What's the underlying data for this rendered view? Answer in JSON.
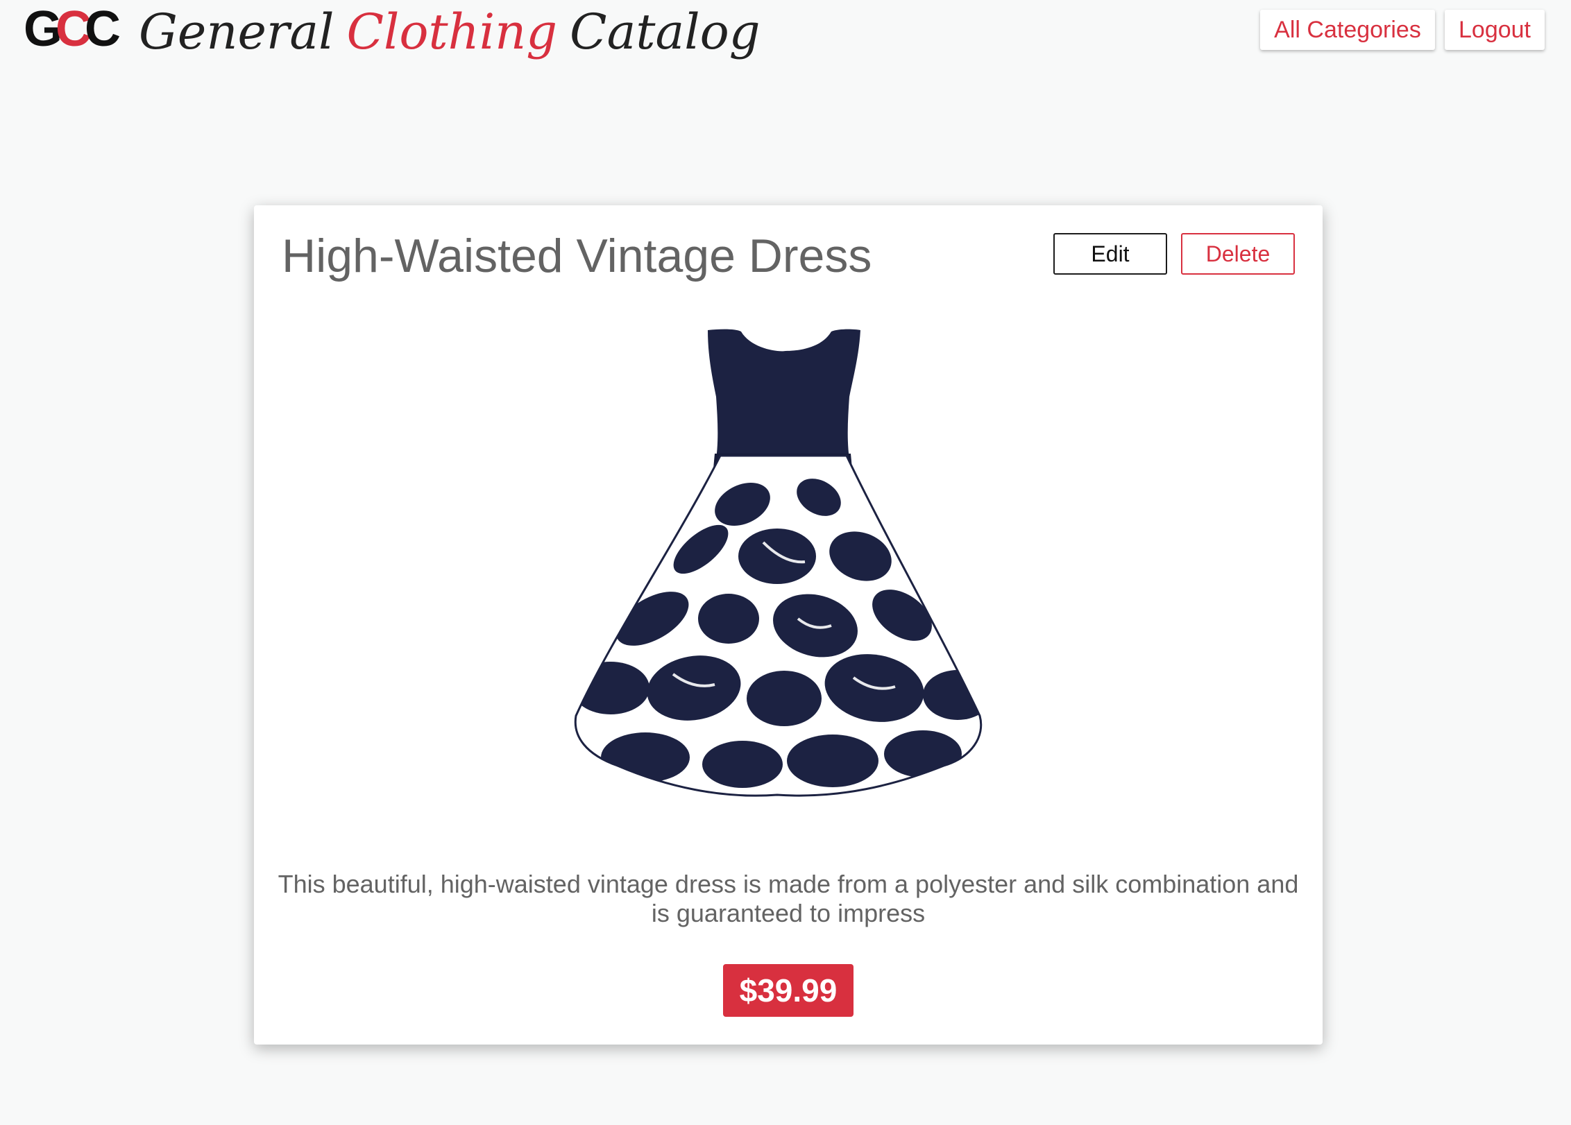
{
  "header": {
    "logo_mark": {
      "first": "G",
      "middle": "C",
      "last": "C"
    },
    "logo_words": [
      "General",
      "Clothing",
      "Catalog"
    ],
    "nav": {
      "categories_label": "All Categories",
      "logout_label": "Logout"
    }
  },
  "product": {
    "title": "High-Waisted Vintage Dress",
    "edit_label": "Edit",
    "delete_label": "Delete",
    "image_alt": "navy floral dress",
    "description": "This beautiful, high-waisted vintage dress is made from a polyester and silk combination and is guaranteed to impress",
    "price": "$39.99"
  },
  "colors": {
    "accent": "#d8303f",
    "text_muted": "#636363",
    "background": "#f8f9f9",
    "dress_navy": "#1c2242"
  }
}
